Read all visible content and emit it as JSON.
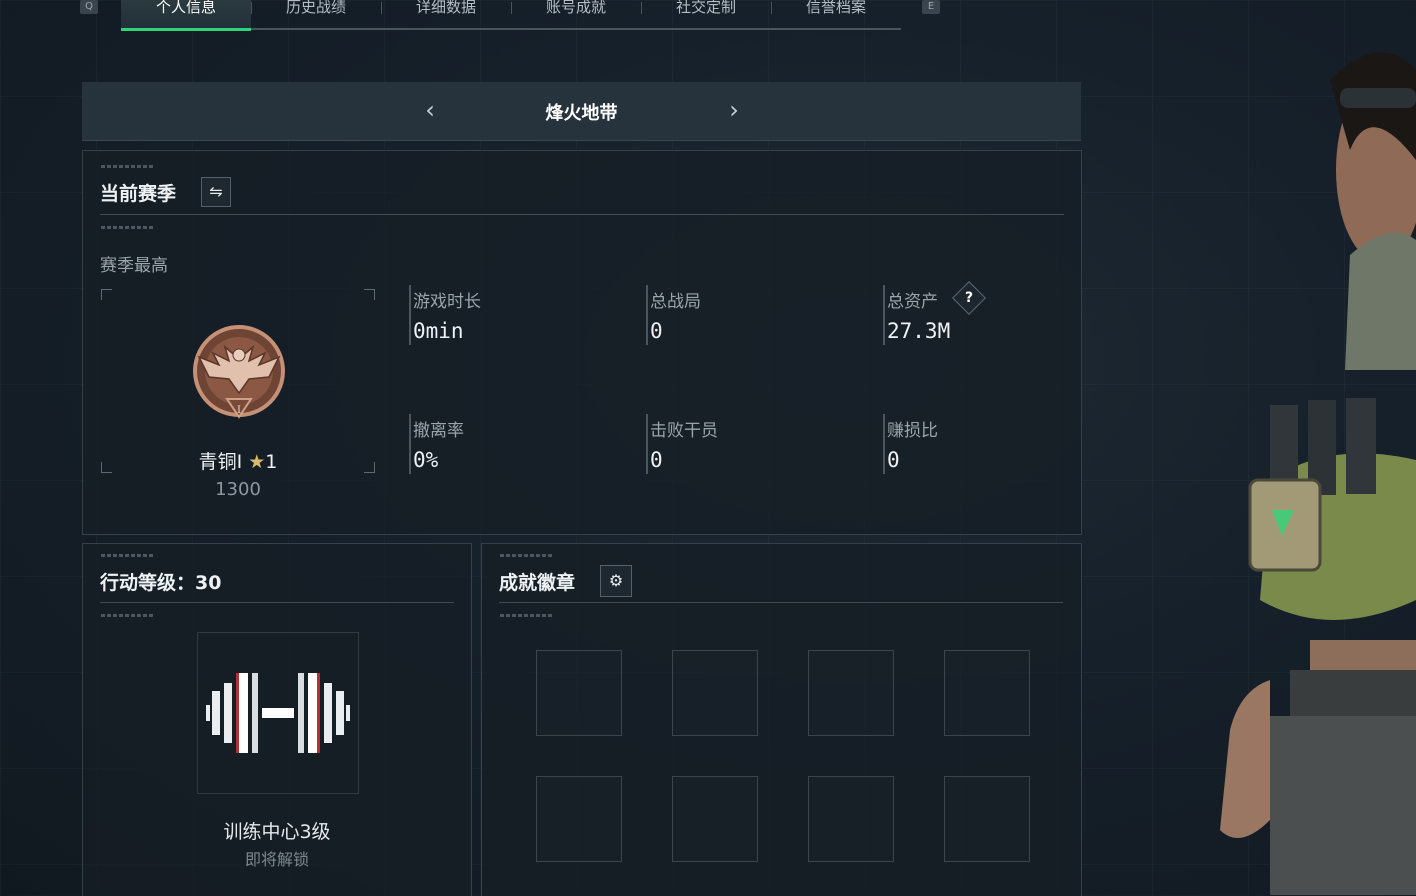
{
  "tabs": {
    "left_key": "Q",
    "right_key": "E",
    "items": [
      "个人信息",
      "历史战绩",
      "详细数据",
      "账号成就",
      "社交定制",
      "信誉档案"
    ]
  },
  "map": {
    "title": "烽火地带",
    "prev_icon": "chevron-left-icon",
    "next_icon": "chevron-right-icon"
  },
  "season": {
    "title": "当前赛季",
    "switch_icon": "swap-icon",
    "subtitle": "赛季最高",
    "rank_name": "青铜I",
    "rank_stars": "1",
    "rank_points": "1300",
    "stats": [
      {
        "label": "游戏时长",
        "value": "0min"
      },
      {
        "label": "总战局",
        "value": "0"
      },
      {
        "label": "总资产",
        "value": "27.3M",
        "help": "?"
      },
      {
        "label": "撤离率",
        "value": "0%"
      },
      {
        "label": "击败干员",
        "value": "0"
      },
      {
        "label": "赚损比",
        "value": "0"
      }
    ]
  },
  "action_level": {
    "title": "行动等级：30",
    "item_name": "训练中心3级",
    "item_status": "即将解锁",
    "icon": "barbell-icon"
  },
  "achievements": {
    "title": "成就徽章",
    "settings_icon": "gear-icon",
    "slot_count": 8
  },
  "colors": {
    "accent": "#2fd47a",
    "rank_bronze": "#a86e52"
  }
}
